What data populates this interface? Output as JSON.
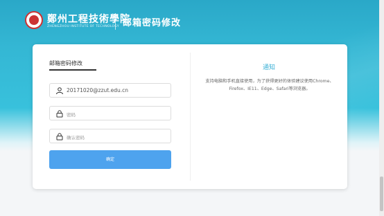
{
  "header": {
    "school_name": "鄭州工程技術學院",
    "school_sub": "ZHENGZHOU INSTITUTE OF TECHNOLOGY",
    "page_title": "邮箱密码修改"
  },
  "form": {
    "tab_label": "邮箱密码修改",
    "email_value": "20171020@zzut.edu.cn",
    "password_placeholder": "密码",
    "confirm_placeholder": "确认密码",
    "submit_label": "确定"
  },
  "notice": {
    "title": "通知",
    "body": "支持电脑和手机直接使用，为了获得更好的体验建议使用Chrome、Firefox、IE11、Edge、Safari等浏览器。"
  },
  "icons": {
    "user": "user-icon",
    "lock": "lock-icon",
    "logo": "school-logo"
  },
  "colors": {
    "accent": "#4ea3ee",
    "header": "#34b7d4",
    "notice_title": "#3ab0d6"
  }
}
